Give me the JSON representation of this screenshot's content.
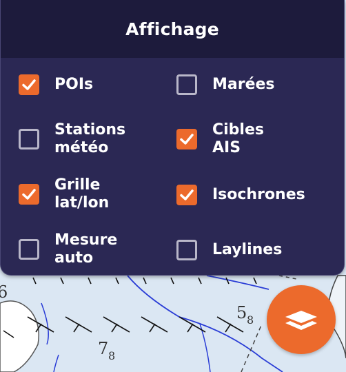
{
  "panel": {
    "title": "Affichage",
    "options": [
      {
        "label": "POIs",
        "checked": true
      },
      {
        "label": "Marées",
        "checked": false
      },
      {
        "label": "Stations\nmétéo",
        "checked": false
      },
      {
        "label": "Cibles\nAIS",
        "checked": true
      },
      {
        "label": "Grille\nlat/lon",
        "checked": true
      },
      {
        "label": "Isochrones",
        "checked": true
      },
      {
        "label": "Mesure\nauto",
        "checked": false
      },
      {
        "label": "Laylines",
        "checked": false
      }
    ]
  },
  "map": {
    "depth_labels": [
      {
        "main": "6",
        "sub": ""
      },
      {
        "main": "5",
        "sub": "8"
      },
      {
        "main": "7",
        "sub": "8"
      }
    ]
  },
  "layers_button": {
    "icon": "layers-icon"
  },
  "colors": {
    "panel_bg": "#2b2854",
    "header_bg": "#1d1b3c",
    "accent": "#ec6a2c",
    "water": "#dbe7f3",
    "land": "#ffffff"
  }
}
